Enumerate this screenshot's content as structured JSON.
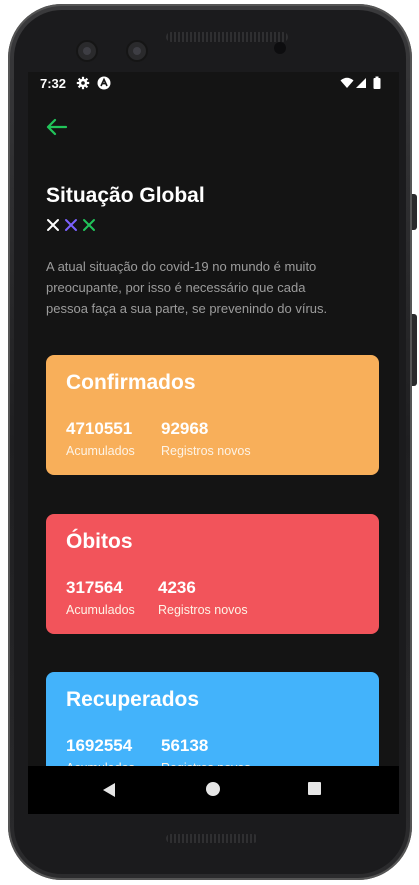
{
  "status_bar": {
    "time": "7:32",
    "icons": [
      "gear-icon",
      "android-a-icon",
      "wifi-icon",
      "signal-icon",
      "battery-icon"
    ]
  },
  "header": {
    "back_icon": "arrow-left-icon",
    "title": "Situação Global",
    "decoration_icons": [
      "x-icon-white",
      "x-icon-purple",
      "x-icon-green"
    ]
  },
  "description": "A atual situação do covid-19 no mundo é muito preocupante, por isso é necessário que cada pessoa faça a sua parte, se prevenindo do vírus.",
  "cards": [
    {
      "title": "Confirmados",
      "color": "#F8AF5A",
      "accumulated": "4710551",
      "accumulated_label": "Acumulados",
      "new": "92968",
      "new_label": "Registros novos"
    },
    {
      "title": "Óbitos",
      "color": "#F2545B",
      "accumulated": "317564",
      "accumulated_label": "Acumulados",
      "new": "4236",
      "new_label": "Registros novos"
    },
    {
      "title": "Recuperados",
      "color": "#43B3FB",
      "accumulated": "1692554",
      "accumulated_label": "Acumulados",
      "new": "56138",
      "new_label": "Registros novos"
    }
  ],
  "colors": {
    "background": "#141414",
    "accent_green": "#21C45A",
    "accent_purple": "#7B61FF"
  },
  "nav_bar": {
    "icons": [
      "back-triangle-icon",
      "home-circle-icon",
      "recents-square-icon"
    ]
  }
}
